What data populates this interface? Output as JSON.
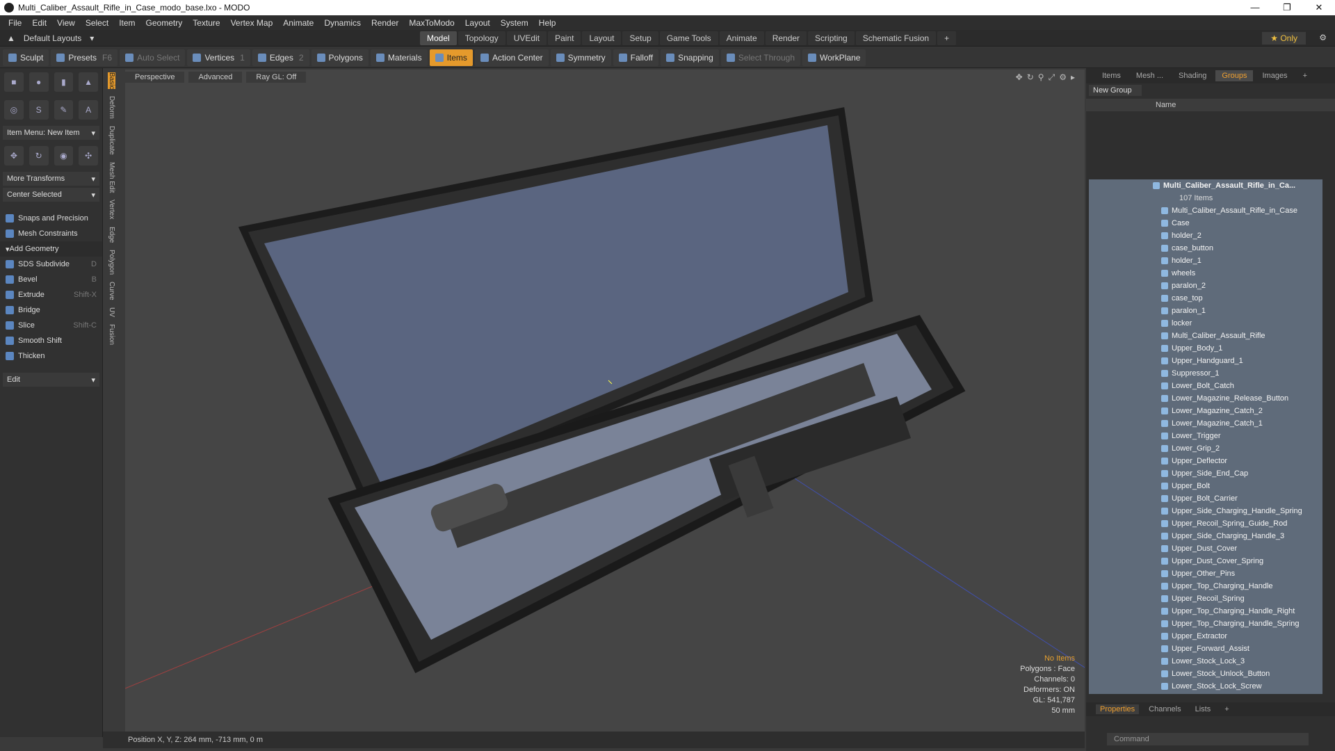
{
  "window": {
    "title": "Multi_Caliber_Assault_Rifle_in_Case_modo_base.lxo - MODO",
    "controls": [
      "—",
      "❐",
      "✕"
    ]
  },
  "menu": [
    "File",
    "Edit",
    "View",
    "Select",
    "Item",
    "Geometry",
    "Texture",
    "Vertex Map",
    "Animate",
    "Dynamics",
    "Render",
    "MaxToModo",
    "Layout",
    "System",
    "Help"
  ],
  "layout": {
    "name": "Default Layouts",
    "tabs": [
      "Model",
      "Topology",
      "UVEdit",
      "Paint",
      "Layout",
      "Setup",
      "Game Tools",
      "Animate",
      "Render",
      "Scripting",
      "Schematic Fusion"
    ],
    "active_tab": "Model",
    "only": "Only"
  },
  "toolbar": {
    "sculpt": "Sculpt",
    "presets": "Presets",
    "presets_key": "F6",
    "auto_select": "Auto Select",
    "vertices": "Vertices",
    "vertices_num": "1",
    "edges": "Edges",
    "edges_num": "2",
    "polygons": "Polygons",
    "materials": "Materials",
    "items": "Items",
    "action_center": "Action Center",
    "symmetry": "Symmetry",
    "falloff": "Falloff",
    "snapping": "Snapping",
    "select_through": "Select Through",
    "workplane": "WorkPlane"
  },
  "left": {
    "item_menu": "Item Menu: New Item",
    "more_transforms": "More Transforms",
    "center_selected": "Center Selected",
    "snaps": "Snaps and Precision",
    "mesh_constraints": "Mesh Constraints",
    "add_geometry": "Add Geometry",
    "tools": [
      {
        "label": "SDS Subdivide",
        "key": "D"
      },
      {
        "label": "Bevel",
        "key": "B"
      },
      {
        "label": "Extrude",
        "key": "Shift-X"
      },
      {
        "label": "Bridge",
        "key": ""
      },
      {
        "label": "Slice",
        "key": "Shift-C"
      },
      {
        "label": "Smooth Shift",
        "key": ""
      },
      {
        "label": "Thicken",
        "key": ""
      }
    ],
    "edit": "Edit",
    "vtabs": [
      "Basic",
      "Deform",
      "Duplicate",
      "Mesh Edit",
      "Vertex",
      "Edge",
      "Polygon",
      "Curve",
      "UV",
      "Fusion"
    ]
  },
  "viewport": {
    "perspective": "Perspective",
    "advanced": "Advanced",
    "raygl": "Ray GL: Off",
    "info": {
      "no_items": "No Items",
      "polygons": "Polygons : Face",
      "channels": "Channels: 0",
      "deformers": "Deformers: ON",
      "gl": "GL: 541,787",
      "focal": "50 mm"
    }
  },
  "status": {
    "position": "Position X, Y, Z:  264 mm, -713 mm, 0 m"
  },
  "right": {
    "tabs": [
      "Items",
      "Mesh ...",
      "Shading",
      "Groups",
      "Images"
    ],
    "active": "Groups",
    "new_group": "New Group",
    "name_col": "Name",
    "root": "Multi_Caliber_Assault_Rifle_in_Ca...",
    "root_count": "107 Items",
    "items": [
      "Multi_Caliber_Assault_Rifle_in_Case",
      "Case",
      "holder_2",
      "case_button",
      "holder_1",
      "wheels",
      "paralon_2",
      "case_top",
      "paralon_1",
      "locker",
      "Multi_Caliber_Assault_Rifle",
      "Upper_Body_1",
      "Upper_Handguard_1",
      "Suppressor_1",
      "Lower_Bolt_Catch",
      "Lower_Magazine_Release_Button",
      "Lower_Magazine_Catch_2",
      "Lower_Magazine_Catch_1",
      "Lower_Trigger",
      "Lower_Grip_2",
      "Upper_Deflector",
      "Upper_Side_End_Cap",
      "Upper_Bolt",
      "Upper_Bolt_Carrier",
      "Upper_Side_Charging_Handle_Spring",
      "Upper_Recoil_Spring_Guide_Rod",
      "Upper_Side_Charging_Handle_3",
      "Upper_Dust_Cover",
      "Upper_Dust_Cover_Spring",
      "Upper_Other_Pins",
      "Upper_Top_Charging_Handle",
      "Upper_Recoil_Spring",
      "Upper_Top_Charging_Handle_Right",
      "Upper_Top_Charging_Handle_Spring",
      "Upper_Extractor",
      "Upper_Forward_Assist",
      "Lower_Stock_Lock_3",
      "Lower_Stock_Unlock_Button",
      "Lower_Stock_Lock_Screw"
    ],
    "bottom_tabs": [
      "Properties",
      "Channels",
      "Lists"
    ],
    "command_placeholder": "Command"
  }
}
